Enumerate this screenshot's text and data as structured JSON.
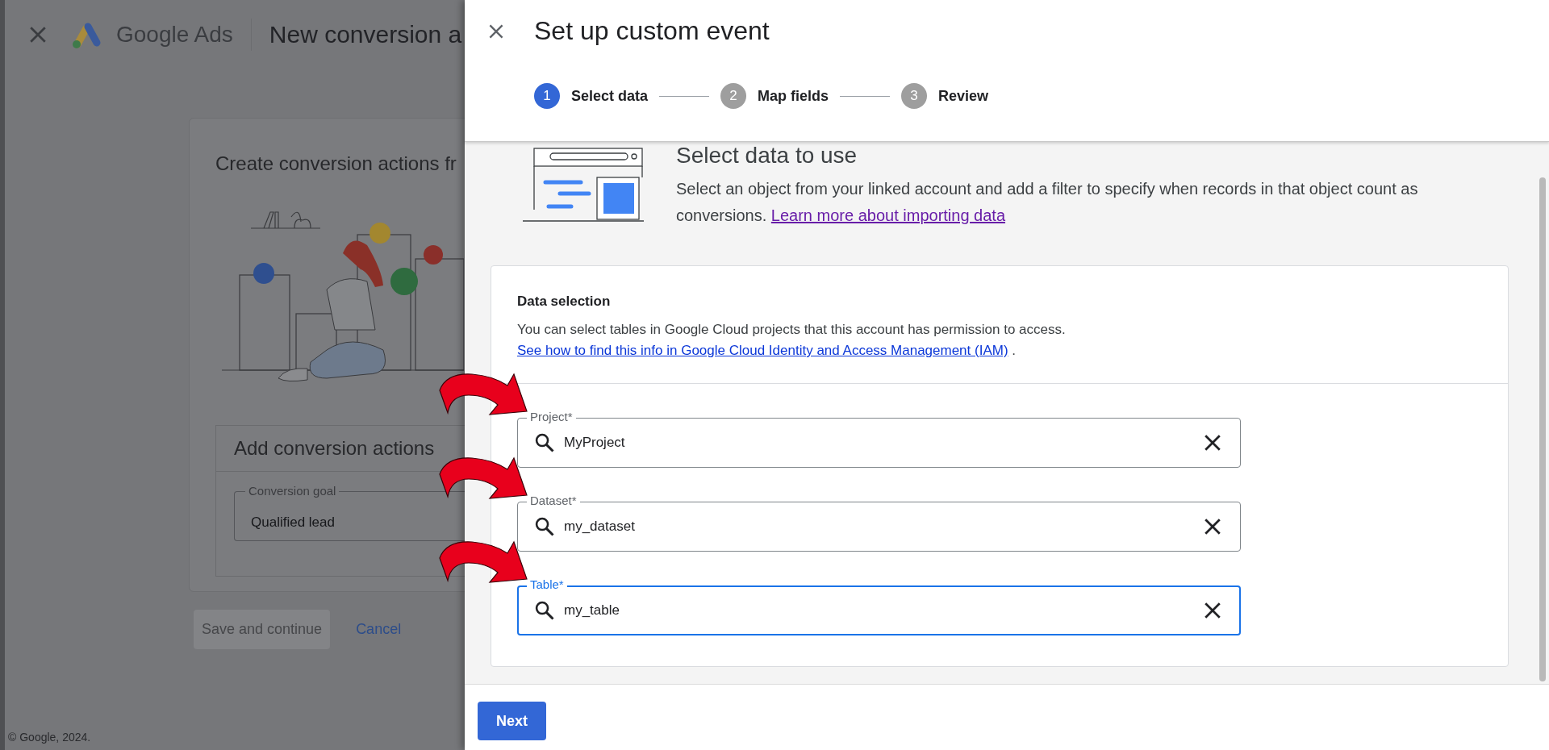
{
  "background_page": {
    "brand": "Google Ads",
    "title": "New conversion a",
    "card": {
      "title": "Create conversion actions fr",
      "section_title": "Add conversion actions",
      "conversion_goal": {
        "label": "Conversion goal",
        "value": "Qualified lead"
      }
    },
    "buttons": [
      {
        "label": "Save and continue",
        "disabled": true
      },
      {
        "label": "Cancel",
        "disabled": false
      }
    ],
    "footer": "© Google, 2024."
  },
  "panel": {
    "title": "Set up custom event",
    "steps": [
      {
        "number": "1",
        "label": "Select data",
        "selected": true
      },
      {
        "number": "2",
        "label": "Map fields",
        "selected": false
      },
      {
        "number": "3",
        "label": "Review",
        "selected": false
      }
    ],
    "section": {
      "heading": "Select data to use",
      "description": "Select an object from your linked account and add a filter to specify when records in that object count as conversions.",
      "link": "Learn more about importing data"
    },
    "data_selection": {
      "title": "Data selection",
      "description": "You can select tables in Google Cloud projects that this account has permission to access.",
      "link": "See how to find this info in Google Cloud Identity and Access Management (IAM)",
      "trailing": "."
    },
    "fields": [
      {
        "label": "Project*",
        "value": "MyProject",
        "focused": false
      },
      {
        "label": "Dataset*",
        "value": "my_dataset",
        "focused": false
      },
      {
        "label": "Table*",
        "value": "my_table",
        "focused": true
      }
    ],
    "next_button": "Next"
  }
}
